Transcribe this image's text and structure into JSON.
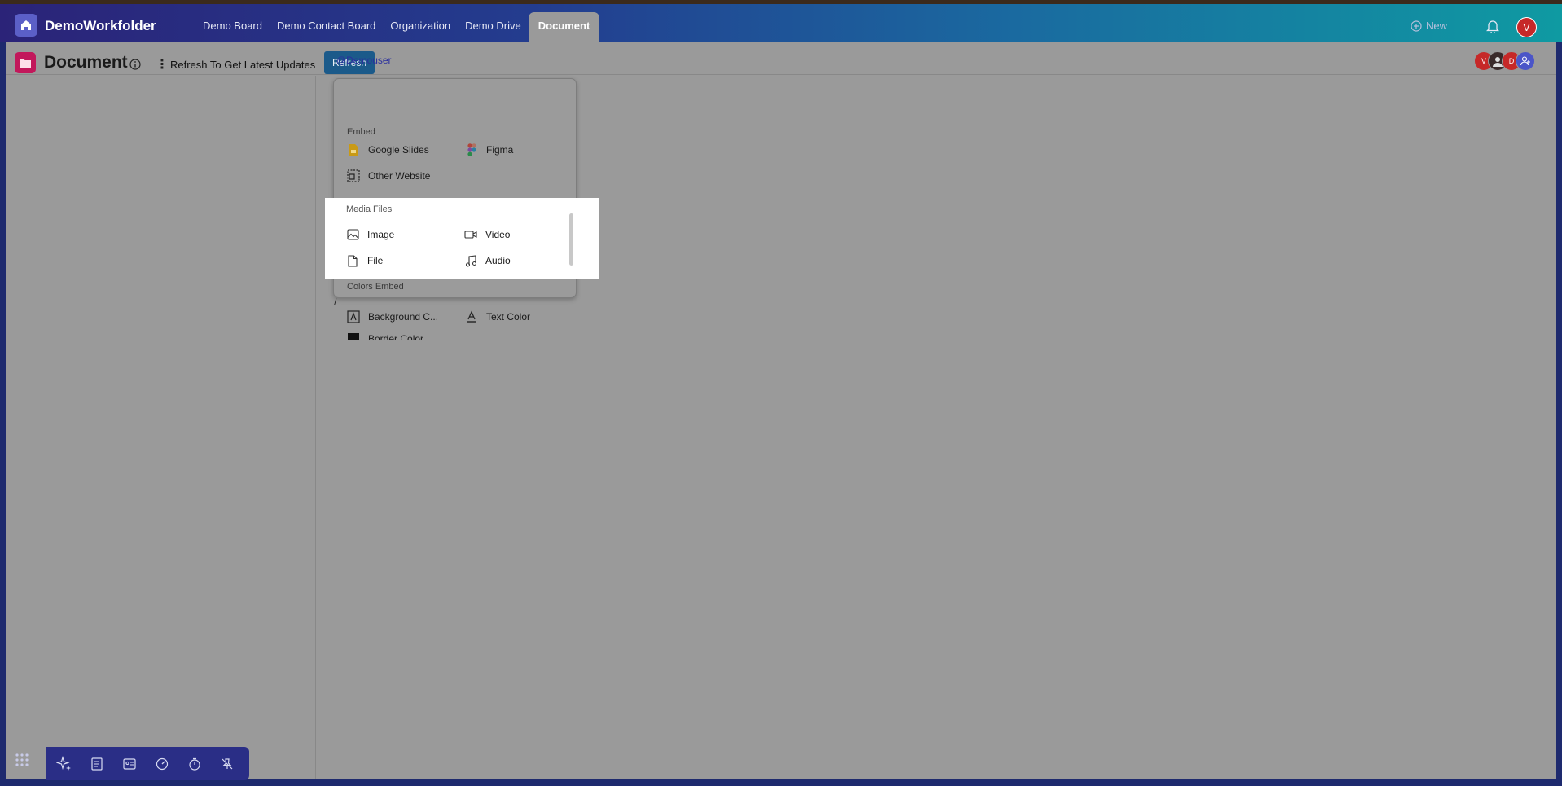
{
  "app": {
    "brand": "DemoWorkfolder"
  },
  "nav": {
    "tabs": [
      {
        "label": "Demo Board"
      },
      {
        "label": "Demo Contact Board"
      },
      {
        "label": "Organization"
      },
      {
        "label": "Demo Drive"
      },
      {
        "label": "Document",
        "active": true
      }
    ],
    "new_label": "New",
    "user_initial": "V"
  },
  "doc": {
    "title": "Document",
    "refresh_text": "Refresh To Get Latest Updates",
    "refresh_button": "Refresh",
    "collaborators": [
      "V",
      "",
      "D",
      ""
    ]
  },
  "editor": {
    "mention": "@Demouser",
    "slash": "/"
  },
  "menu": {
    "embed_title": "Embed",
    "embed_items": [
      "Google Slides",
      "Figma",
      "Other Website"
    ],
    "media_title": "Media Files",
    "media_items": [
      "Image",
      "Video",
      "File",
      "Audio"
    ],
    "colors_title": "Colors Embed",
    "colors_items": [
      "Background C...",
      "Text Color",
      "Border Color"
    ]
  },
  "colors": {
    "accent": "#1b5a8a",
    "doc_icon": "#c2185b",
    "avatar": "#c62828"
  }
}
